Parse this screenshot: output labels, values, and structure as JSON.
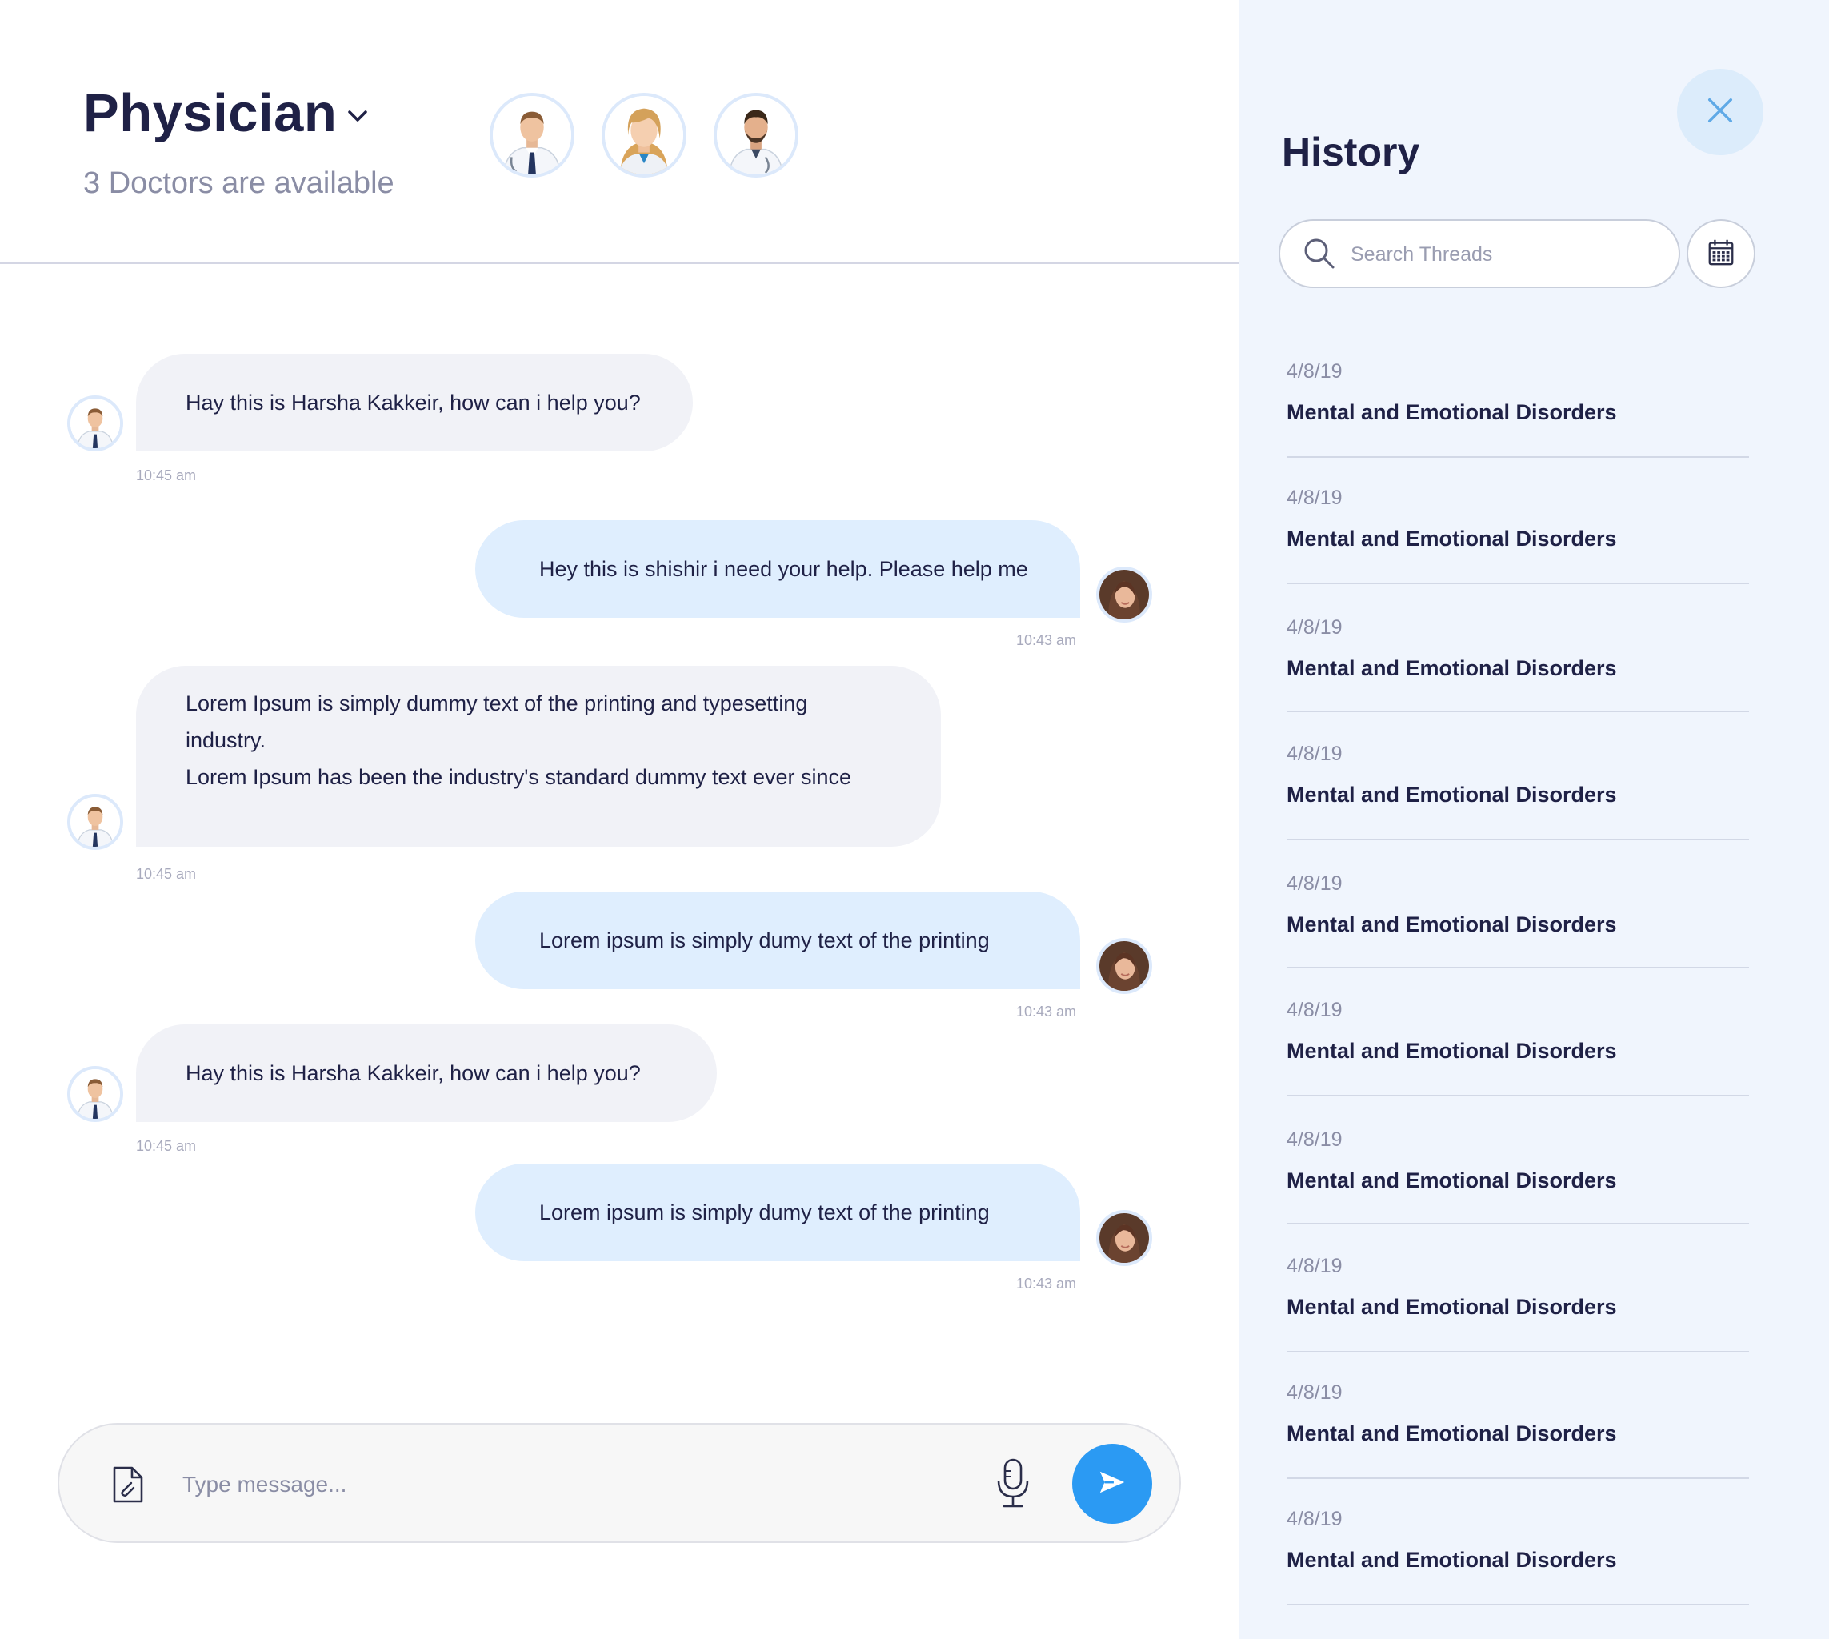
{
  "header": {
    "title": "Physician",
    "subtitle": "3 Doctors are available",
    "doctors": [
      "doctor-male-1",
      "doctor-female",
      "doctor-male-2"
    ]
  },
  "messages": [
    {
      "side": "in",
      "text": "Hay this is Harsha Kakkeir, how can i help you?",
      "time": "10:45 am",
      "avatar": "doctor-male-1"
    },
    {
      "side": "out",
      "text": "Hey this is shishir i need your help. Please help me",
      "time": "10:43 am",
      "avatar": "patient-female"
    },
    {
      "side": "in",
      "lines": [
        "Lorem Ipsum is simply dummy text of the printing and typesetting industry.",
        "Lorem Ipsum has been the industry's standard dummy text ever since"
      ],
      "time": "10:45 am",
      "avatar": "doctor-male-1"
    },
    {
      "side": "out",
      "text": "Lorem ipsum is simply dumy text of the printing",
      "time": "10:43 am",
      "avatar": "patient-female"
    },
    {
      "side": "in",
      "text": "Hay this is Harsha Kakkeir, how can i help you?",
      "time": "10:45 am",
      "avatar": "doctor-male-1"
    },
    {
      "side": "out",
      "text": "Lorem ipsum is simply dumy text of the printing",
      "time": "10:43 am",
      "avatar": "patient-female"
    }
  ],
  "composer": {
    "placeholder": "Type message...",
    "icons": {
      "attach": "attachment-icon",
      "mic": "microphone-icon",
      "send": "send-icon"
    }
  },
  "history": {
    "title": "History",
    "search_placeholder": "Search Threads",
    "threads": [
      {
        "date": "4/8/19",
        "title": "Mental and Emotional Disorders"
      },
      {
        "date": "4/8/19",
        "title": "Mental and Emotional Disorders"
      },
      {
        "date": "4/8/19",
        "title": "Mental and Emotional Disorders"
      },
      {
        "date": "4/8/19",
        "title": "Mental and Emotional Disorders"
      },
      {
        "date": "4/8/19",
        "title": "Mental and Emotional Disorders"
      },
      {
        "date": "4/8/19",
        "title": "Mental and Emotional Disorders"
      },
      {
        "date": "4/8/19",
        "title": "Mental and Emotional Disorders"
      },
      {
        "date": "4/8/19",
        "title": "Mental and Emotional Disorders"
      },
      {
        "date": "4/8/19",
        "title": "Mental and Emotional Disorders"
      },
      {
        "date": "4/8/19",
        "title": "Mental and Emotional Disorders"
      }
    ]
  },
  "colors": {
    "accent": "#2b9af3",
    "text_dark": "#1f2146",
    "text_muted": "#8a8da5",
    "incoming_bubble": "#f1f2f7",
    "outgoing_bubble": "#dfeefe",
    "sidebar_bg": "#f0f5fd"
  }
}
